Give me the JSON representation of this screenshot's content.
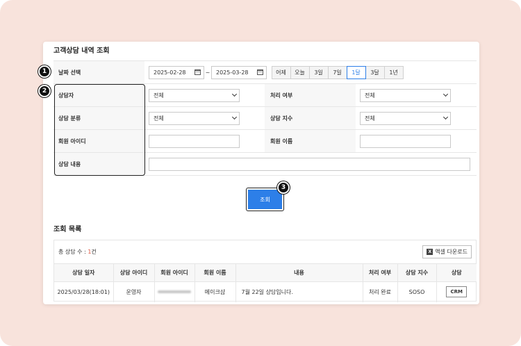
{
  "search_section": {
    "title": "고객상담 내역 조회",
    "date_label": "날짜 선택",
    "date_from": "2025-02-28",
    "date_to": "2025-03-28",
    "date_sep": "~",
    "periods": [
      "어제",
      "오늘",
      "3일",
      "7일",
      "1달",
      "3달",
      "1년"
    ],
    "active_period": "1달",
    "counselor_label": "상담자",
    "counselor_value": "전체",
    "status_label": "처리 여부",
    "status_value": "전체",
    "category_label": "상담 분류",
    "category_value": "전체",
    "index_label": "상담 지수",
    "index_value": "전체",
    "member_id_label": "회원 아이디",
    "member_name_label": "회원 이름",
    "content_label": "상담 내용",
    "search_button": "조회"
  },
  "badges": [
    "1",
    "2",
    "3"
  ],
  "result_section": {
    "title": "조회 목록",
    "count_prefix": "총 상담 수 : ",
    "count_value": "1",
    "count_suffix": "건",
    "excel_icon_text": "X",
    "excel_button": "액셀 다운로드",
    "columns": [
      "상담 일자",
      "상담 아이디",
      "회원 아이디",
      "회원 이름",
      "내용",
      "처리 여부",
      "상담 지수",
      "상담"
    ],
    "rows": [
      {
        "date": "2025/03/28(18:01)",
        "counselor_id": "운영자",
        "member_name": "메이크샵",
        "content": "7월 22일 상담입니다.",
        "status": "처리 완료",
        "index": "SOSO",
        "crm_button": "CRM"
      }
    ]
  },
  "colors": {
    "background": "#f8e3dc",
    "accent": "#2d7fe8",
    "count_highlight": "#e0533b"
  }
}
